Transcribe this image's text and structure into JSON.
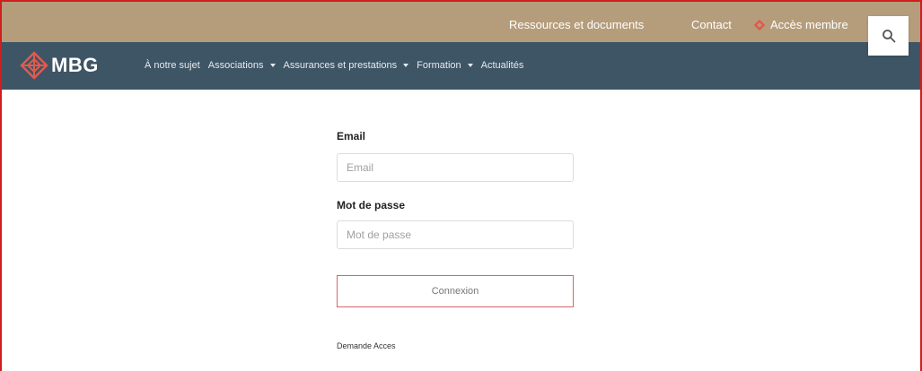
{
  "topbar": {
    "resources": "Ressources et documents",
    "contact": "Contact",
    "member_access": "Accès membre"
  },
  "icons": {
    "member": "diamond-logo-icon",
    "search": "search-icon",
    "logo": "diamond-logo-icon"
  },
  "colors": {
    "topbar_bg": "#b59d7c",
    "navbar_bg": "#3e5566",
    "accent": "#d9646a"
  },
  "header": {
    "logo_text": "MBG"
  },
  "nav": {
    "items": [
      {
        "label": "À notre sujet"
      },
      {
        "label": "Associations"
      },
      {
        "label": "Assurances et prestations"
      },
      {
        "label": "Formation"
      },
      {
        "label": "Actualités"
      }
    ]
  },
  "form": {
    "email_label": "Email",
    "email_placeholder": "Email",
    "email_value": "",
    "password_label": "Mot de passe",
    "password_placeholder": "Mot de passe",
    "password_value": "",
    "submit_label": "Connexion",
    "request_link": "Demande Acces"
  }
}
